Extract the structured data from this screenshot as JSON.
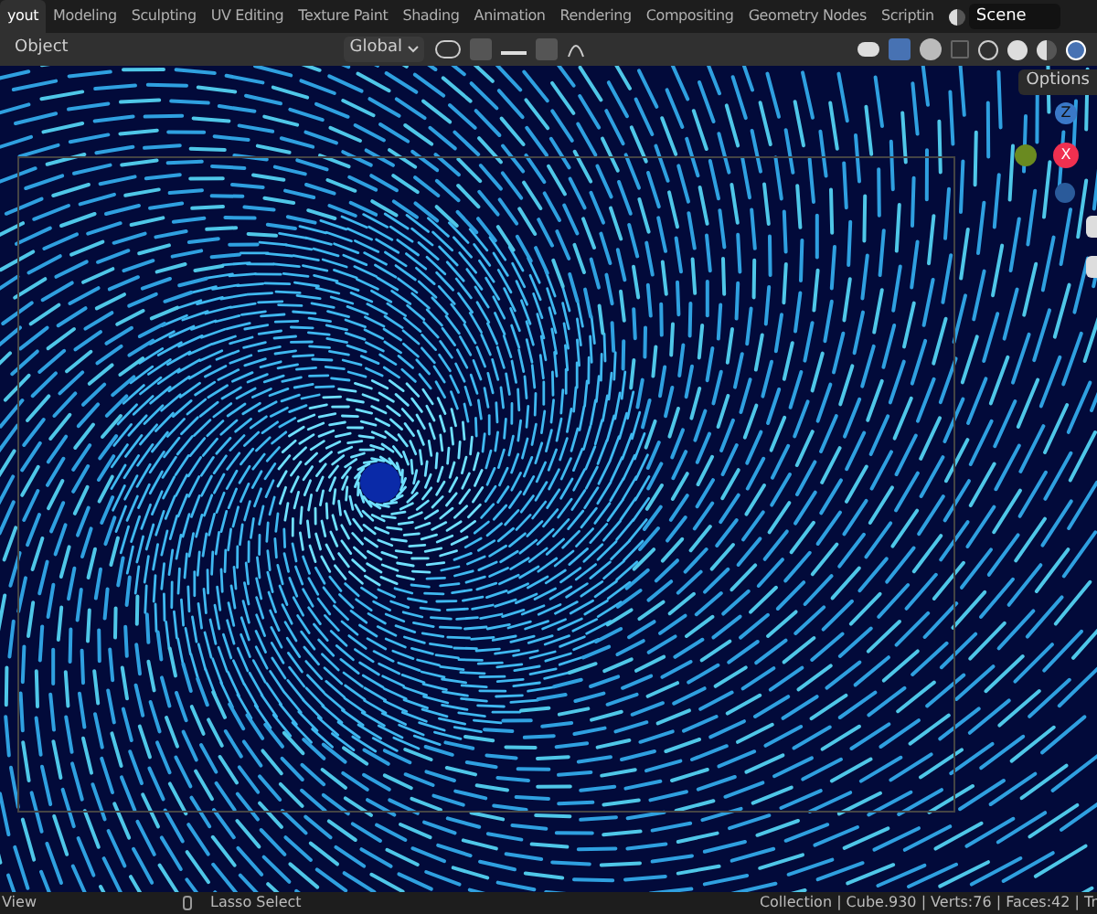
{
  "workspace_tabs": [
    {
      "label": "yout",
      "selected": true
    },
    {
      "label": "Modeling",
      "selected": false
    },
    {
      "label": "Sculpting",
      "selected": false
    },
    {
      "label": "UV Editing",
      "selected": false
    },
    {
      "label": "Texture Paint",
      "selected": false
    },
    {
      "label": "Shading",
      "selected": false
    },
    {
      "label": "Animation",
      "selected": false
    },
    {
      "label": "Rendering",
      "selected": false
    },
    {
      "label": "Compositing",
      "selected": false
    },
    {
      "label": "Geometry Nodes",
      "selected": false
    },
    {
      "label": "Scriptin",
      "selected": false
    }
  ],
  "scene_field": {
    "value": "Scene"
  },
  "header": {
    "mode": "Object",
    "orientation": "Global"
  },
  "viewport": {
    "options_button": "Options",
    "gizmo": {
      "z_label": "Z",
      "x_label": "X"
    }
  },
  "status_bar": {
    "left": "View",
    "middle": "Lasso Select",
    "right": "Collection | Cube.930 | Verts:76 | Faces:42 | Tr"
  }
}
